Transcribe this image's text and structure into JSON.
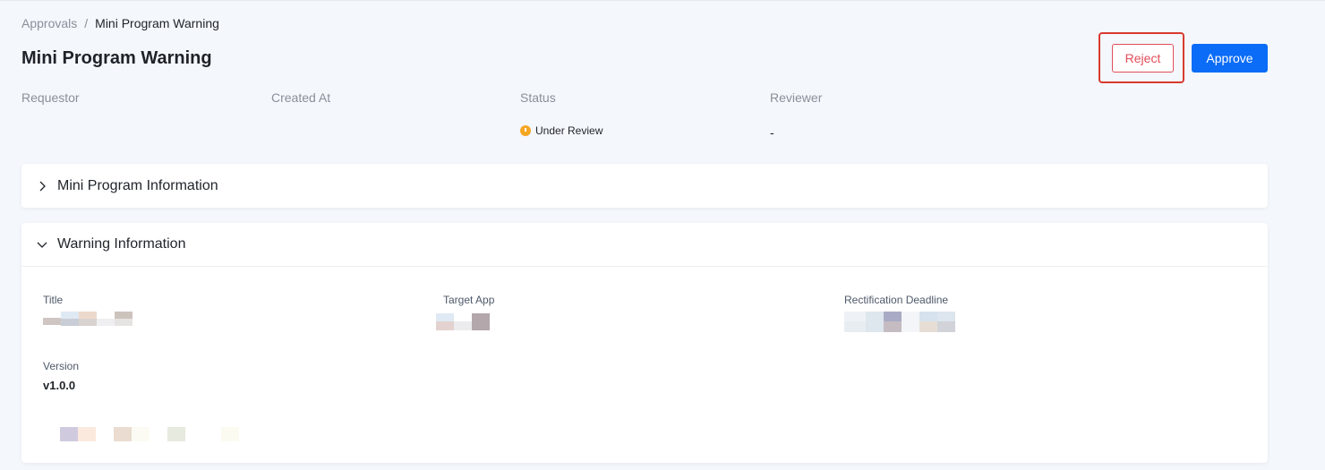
{
  "breadcrumb": {
    "parent": "Approvals",
    "separator": "/",
    "current": "Mini Program Warning"
  },
  "page": {
    "title": "Mini Program Warning"
  },
  "actions": {
    "reject_label": "Reject",
    "approve_label": "Approve"
  },
  "meta": {
    "requestor_label": "Requestor",
    "created_at_label": "Created At",
    "status_label": "Status",
    "reviewer_label": "Reviewer",
    "status_value": "Under Review",
    "reviewer_value": "-"
  },
  "sections": {
    "mini_program": {
      "title": "Mini Program Information",
      "expanded": false
    },
    "warning": {
      "title": "Warning Information",
      "expanded": true
    }
  },
  "warning_fields": {
    "title_label": "Title",
    "target_app_label": "Target App",
    "deadline_label": "Rectification Deadline",
    "version_label": "Version",
    "version_value": "v1.0.0"
  },
  "colors": {
    "primary": "#0a6cf7",
    "danger": "#e34d59",
    "highlight": "#d83b2f",
    "warning": "#f5a623"
  },
  "icons": {
    "collapsed": "chevron-right-icon",
    "expanded": "chevron-down-icon",
    "status": "clock-icon"
  }
}
